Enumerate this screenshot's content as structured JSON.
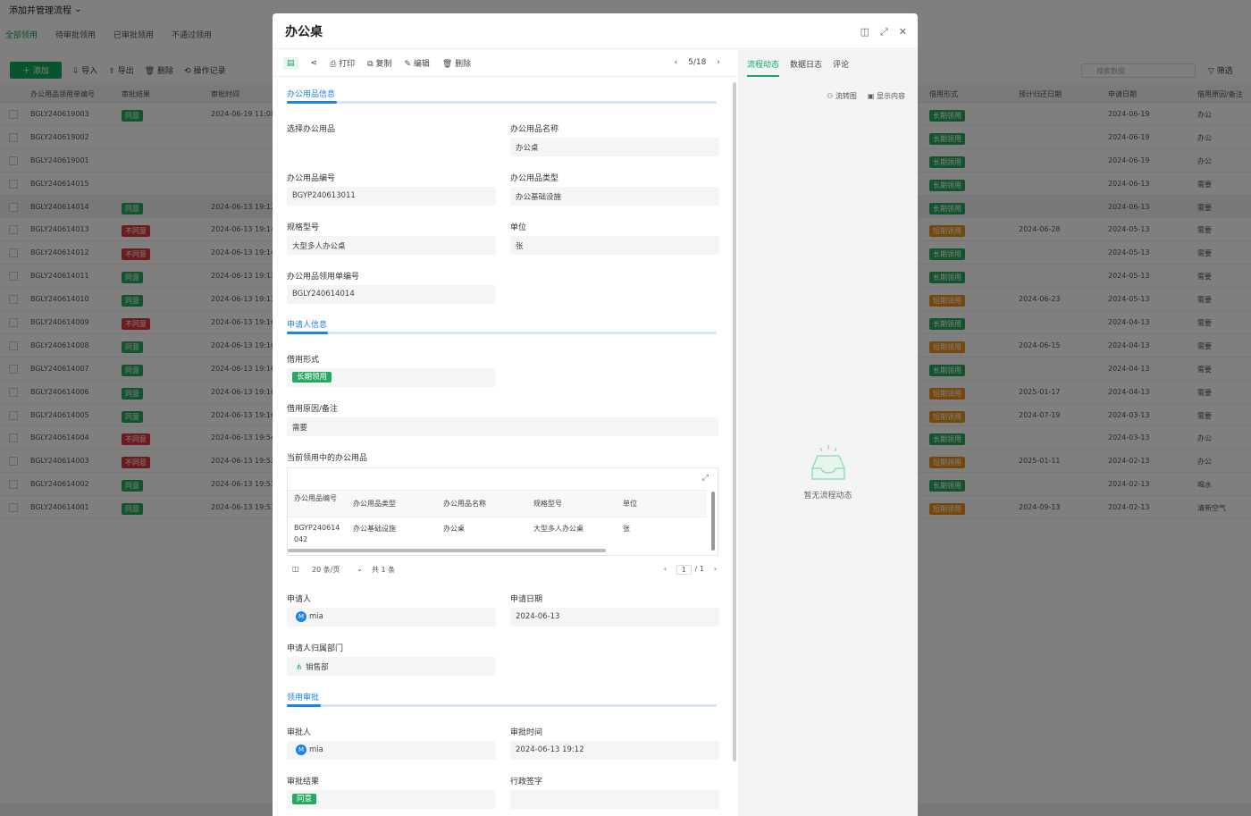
{
  "app": {
    "title": "添加并管理流程"
  },
  "tabs": [
    "全部领用",
    "待审批领用",
    "已审批领用",
    "不通过领用"
  ],
  "toolbar": {
    "add": "添加",
    "import": "导入",
    "export": "导出",
    "delete": "删除",
    "log": "操作记录",
    "search_placeholder": "搜索数据",
    "filter": "筛选"
  },
  "table": {
    "left_headers": [
      "办公用品领用单编号",
      "审批结果",
      "审批时间"
    ],
    "right_headers": [
      "借用形式",
      "预计归还日期",
      "申请日期",
      "借用原因/备注"
    ],
    "rows": [
      {
        "id": "BGLY240619003",
        "result": "同意",
        "time": "2024-06-19 11:08",
        "form": "长期领用",
        "due": "",
        "date": "2024-06-19",
        "note": "办公"
      },
      {
        "id": "BGLY240619002",
        "result": "",
        "time": "",
        "form": "长期领用",
        "due": "",
        "date": "2024-06-19",
        "note": "办公"
      },
      {
        "id": "BGLY240619001",
        "result": "",
        "time": "",
        "form": "长期领用",
        "due": "",
        "date": "2024-06-19",
        "note": "办公"
      },
      {
        "id": "BGLY240614015",
        "result": "",
        "time": "",
        "form": "长期领用",
        "due": "",
        "date": "2024-06-13",
        "note": "需要"
      },
      {
        "id": "BGLY240614014",
        "result": "同意",
        "time": "2024-06-13 19:12",
        "form": "长期领用",
        "due": "",
        "date": "2024-06-13",
        "note": "需要"
      },
      {
        "id": "BGLY240614013",
        "result": "不同意",
        "time": "2024-06-13 19:14",
        "form": "短期领用",
        "due": "2024-06-28",
        "date": "2024-05-13",
        "note": "需要"
      },
      {
        "id": "BGLY240614012",
        "result": "不同意",
        "time": "2024-06-13 19:14",
        "form": "长期领用",
        "due": "",
        "date": "2024-05-13",
        "note": "需要"
      },
      {
        "id": "BGLY240614011",
        "result": "同意",
        "time": "2024-06-13 19:13",
        "form": "长期领用",
        "due": "",
        "date": "2024-05-13",
        "note": "需要"
      },
      {
        "id": "BGLY240614010",
        "result": "同意",
        "time": "2024-06-13 19:13",
        "form": "短期领用",
        "due": "2024-06-23",
        "date": "2024-05-13",
        "note": "需要"
      },
      {
        "id": "BGLY240614009",
        "result": "不同意",
        "time": "2024-06-13 19:16",
        "form": "长期领用",
        "due": "",
        "date": "2024-04-13",
        "note": "需要"
      },
      {
        "id": "BGLY240614008",
        "result": "同意",
        "time": "2024-06-13 19:16",
        "form": "短期领用",
        "due": "2024-06-15",
        "date": "2024-04-13",
        "note": "需要"
      },
      {
        "id": "BGLY240614007",
        "result": "同意",
        "time": "2024-06-13 19:16",
        "form": "长期领用",
        "due": "",
        "date": "2024-04-13",
        "note": "需要"
      },
      {
        "id": "BGLY240614006",
        "result": "同意",
        "time": "2024-06-13 19:16",
        "form": "短期领用",
        "due": "2025-01-17",
        "date": "2024-04-13",
        "note": "需要"
      },
      {
        "id": "BGLY240614005",
        "result": "同意",
        "time": "2024-06-13 19:16",
        "form": "短期领用",
        "due": "2024-07-19",
        "date": "2024-03-13",
        "note": "需要"
      },
      {
        "id": "BGLY240614004",
        "result": "不同意",
        "time": "2024-06-13 19:54",
        "form": "长期领用",
        "due": "",
        "date": "2024-03-13",
        "note": "办公"
      },
      {
        "id": "BGLY240614003",
        "result": "不同意",
        "time": "2024-06-13 19:53",
        "form": "短期领用",
        "due": "2025-01-11",
        "date": "2024-02-13",
        "note": "办公"
      },
      {
        "id": "BGLY240614002",
        "result": "同意",
        "time": "2024-06-13 19:53",
        "form": "长期领用",
        "due": "",
        "date": "2024-02-13",
        "note": "喝水"
      },
      {
        "id": "BGLY240614001",
        "result": "同意",
        "time": "2024-06-13 19:53",
        "form": "短期领用",
        "due": "2024-09-13",
        "date": "2024-02-13",
        "note": "清新空气"
      }
    ]
  },
  "modal": {
    "title": "办公桌",
    "toolbar": {
      "print": "打印",
      "copy": "复制",
      "edit": "编辑",
      "delete": "删除",
      "pager": "5/18"
    },
    "sections": {
      "item_info": "办公用品信息",
      "applicant_info": "申请人信息",
      "approval": "领用审批"
    },
    "fields": {
      "select_item": {
        "label": "选择办公用品"
      },
      "item_name": {
        "label": "办公用品名称",
        "value": "办公桌"
      },
      "item_no": {
        "label": "办公用品编号",
        "value": "BGYP240613011"
      },
      "item_type": {
        "label": "办公用品类型",
        "value": "办公基础设施"
      },
      "spec": {
        "label": "规格型号",
        "value": "大型多人办公桌"
      },
      "unit": {
        "label": "单位",
        "value": "张"
      },
      "req_no": {
        "label": "办公用品领用单编号",
        "value": "BGLY240614014"
      },
      "borrow_form": {
        "label": "借用形式",
        "value": "长期领用"
      },
      "reason": {
        "label": "借用原因/备注",
        "value": "需要"
      },
      "current_items": {
        "label": "当前领用中的办公用品"
      },
      "applicant": {
        "label": "申请人",
        "value": "mia",
        "avatar": "M"
      },
      "apply_date": {
        "label": "申请日期",
        "value": "2024-06-13"
      },
      "dept": {
        "label": "申请人归属部门",
        "value": "销售部"
      },
      "approver": {
        "label": "审批人",
        "value": "mia",
        "avatar": "M"
      },
      "approve_time": {
        "label": "审批时间",
        "value": "2024-06-13 19:12"
      },
      "approve_result": {
        "label": "审批结果",
        "value": "同意"
      },
      "admin_sign": {
        "label": "行政签字"
      }
    },
    "subtable": {
      "headers": [
        "办公用品编号",
        "办公用品类型",
        "办公用品名称",
        "规格型号",
        "单位"
      ],
      "row": [
        "BGYP240614042",
        "办公基础设施",
        "办公桌",
        "大型多人办公桌",
        "张"
      ],
      "per_page": "20 条/页",
      "total": "共 1 条",
      "page": "1",
      "pages": "/ 1"
    },
    "side": {
      "tabs": [
        "流程动态",
        "数据日志",
        "评论"
      ],
      "flowchart": "流转图",
      "show_content": "显示内容",
      "empty": "暂无流程动态"
    }
  }
}
